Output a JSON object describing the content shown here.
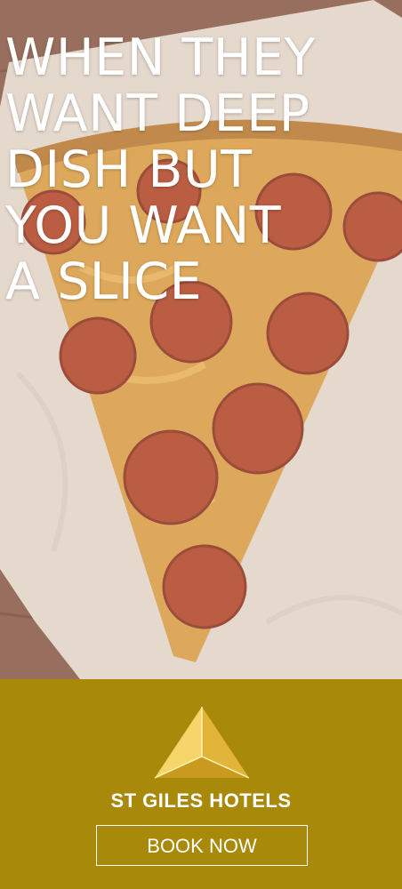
{
  "headline": {
    "lines": [
      "WHEN THEY",
      "WANT DEEP",
      "DISH BUT",
      "YOU WANT",
      "A SLICE"
    ]
  },
  "footer": {
    "logo_icon": "triangle-logo-icon",
    "brand_name": "ST GILES HOTELS",
    "cta_label": "BOOK NOW"
  },
  "colors": {
    "footer_bg": "#a8890a",
    "text": "#ffffff",
    "paper": "#e4d7cb",
    "crust": "#d89b43",
    "pepperoni": "#b2472a"
  }
}
